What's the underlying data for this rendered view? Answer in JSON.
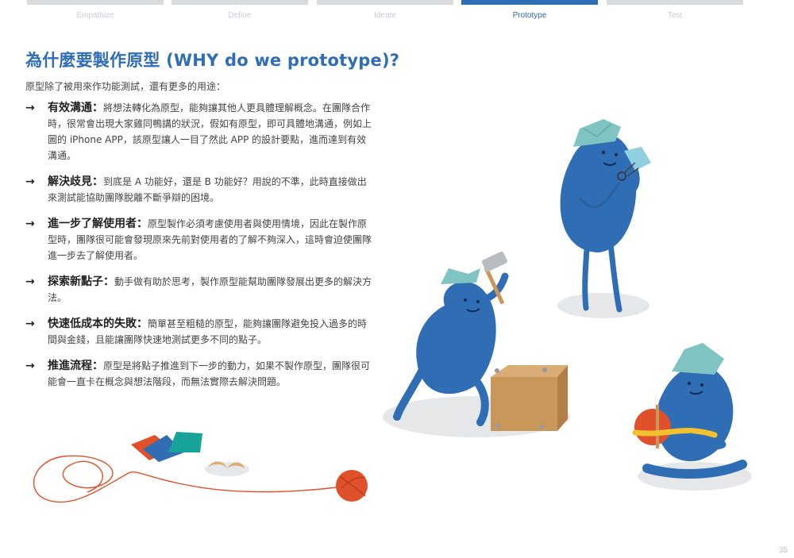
{
  "tabs": [
    {
      "label": "Empathize",
      "active": false
    },
    {
      "label": "Define",
      "active": false
    },
    {
      "label": "Ideate",
      "active": false
    },
    {
      "label": "Prototype",
      "active": true
    },
    {
      "label": "Test",
      "active": false
    }
  ],
  "title": "為什麼要製作原型 (WHY do we prototype)?",
  "intro": "原型除了被用來作功能測試，還有更多的用途：",
  "items": [
    {
      "head": "有效溝通",
      "text": "將想法轉化為原型，能夠讓其他人更具體理解概念。在團隊合作時，很常會出現大家雞同鴨講的狀況，假如有原型，即可具體地溝通，例如上圖的 iPhone APP，該原型讓人一目了然此 APP 的設計要點，進而達到有效溝通。"
    },
    {
      "head": "解決歧見",
      "text": "到底是 A 功能好，還是 B 功能好？用說的不準，此時直接做出來測試能協助團隊脫離不斷爭辯的困境。"
    },
    {
      "head": "進一步了解使用者",
      "text": "原型製作必須考慮使用者與使用情境，因此在製作原型時，團隊很可能會發現原來先前對使用者的了解不夠深入，這時會迫使團隊進一步去了解使用者。"
    },
    {
      "head": "探索新點子",
      "text": "動手做有助於思考，製作原型能幫助團隊發展出更多的解決方法。"
    },
    {
      "head": "快速低成本的失敗",
      "text": "簡單甚至粗糙的原型，能夠讓團隊避免投入過多的時間與金錢，且能讓團隊快速地測試更多不同的點子。"
    },
    {
      "head": "推進流程",
      "text": "原型是將點子推進到下一步的動力，如果不製作原型，團隊很可能會一直卡在概念與想法階段，而無法實際去解決問題。"
    }
  ],
  "arrow_glyph": "→",
  "colon": "：",
  "page_number": "35",
  "colors": {
    "accent": "#2f6db5",
    "character": "#2f6db5",
    "tab_inactive": "#d9dadc",
    "box": "#c9975a",
    "paper_hat": "#7fc4c2",
    "yarn": "#e0502a"
  }
}
